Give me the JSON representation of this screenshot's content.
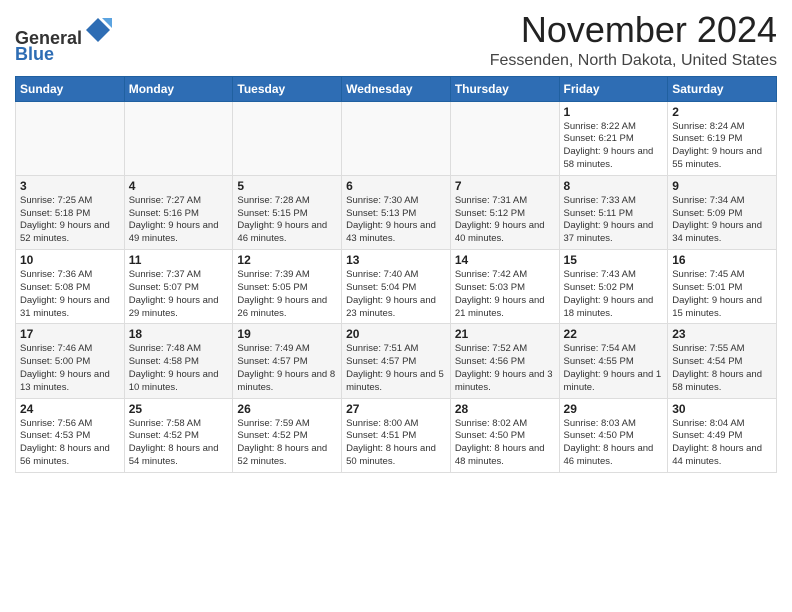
{
  "header": {
    "logo_line1": "General",
    "logo_line2": "Blue",
    "month_title": "November 2024",
    "location": "Fessenden, North Dakota, United States"
  },
  "days_of_week": [
    "Sunday",
    "Monday",
    "Tuesday",
    "Wednesday",
    "Thursday",
    "Friday",
    "Saturday"
  ],
  "weeks": [
    [
      {
        "day": "",
        "info": ""
      },
      {
        "day": "",
        "info": ""
      },
      {
        "day": "",
        "info": ""
      },
      {
        "day": "",
        "info": ""
      },
      {
        "day": "",
        "info": ""
      },
      {
        "day": "1",
        "info": "Sunrise: 8:22 AM\nSunset: 6:21 PM\nDaylight: 9 hours and 58 minutes."
      },
      {
        "day": "2",
        "info": "Sunrise: 8:24 AM\nSunset: 6:19 PM\nDaylight: 9 hours and 55 minutes."
      }
    ],
    [
      {
        "day": "3",
        "info": "Sunrise: 7:25 AM\nSunset: 5:18 PM\nDaylight: 9 hours and 52 minutes."
      },
      {
        "day": "4",
        "info": "Sunrise: 7:27 AM\nSunset: 5:16 PM\nDaylight: 9 hours and 49 minutes."
      },
      {
        "day": "5",
        "info": "Sunrise: 7:28 AM\nSunset: 5:15 PM\nDaylight: 9 hours and 46 minutes."
      },
      {
        "day": "6",
        "info": "Sunrise: 7:30 AM\nSunset: 5:13 PM\nDaylight: 9 hours and 43 minutes."
      },
      {
        "day": "7",
        "info": "Sunrise: 7:31 AM\nSunset: 5:12 PM\nDaylight: 9 hours and 40 minutes."
      },
      {
        "day": "8",
        "info": "Sunrise: 7:33 AM\nSunset: 5:11 PM\nDaylight: 9 hours and 37 minutes."
      },
      {
        "day": "9",
        "info": "Sunrise: 7:34 AM\nSunset: 5:09 PM\nDaylight: 9 hours and 34 minutes."
      }
    ],
    [
      {
        "day": "10",
        "info": "Sunrise: 7:36 AM\nSunset: 5:08 PM\nDaylight: 9 hours and 31 minutes."
      },
      {
        "day": "11",
        "info": "Sunrise: 7:37 AM\nSunset: 5:07 PM\nDaylight: 9 hours and 29 minutes."
      },
      {
        "day": "12",
        "info": "Sunrise: 7:39 AM\nSunset: 5:05 PM\nDaylight: 9 hours and 26 minutes."
      },
      {
        "day": "13",
        "info": "Sunrise: 7:40 AM\nSunset: 5:04 PM\nDaylight: 9 hours and 23 minutes."
      },
      {
        "day": "14",
        "info": "Sunrise: 7:42 AM\nSunset: 5:03 PM\nDaylight: 9 hours and 21 minutes."
      },
      {
        "day": "15",
        "info": "Sunrise: 7:43 AM\nSunset: 5:02 PM\nDaylight: 9 hours and 18 minutes."
      },
      {
        "day": "16",
        "info": "Sunrise: 7:45 AM\nSunset: 5:01 PM\nDaylight: 9 hours and 15 minutes."
      }
    ],
    [
      {
        "day": "17",
        "info": "Sunrise: 7:46 AM\nSunset: 5:00 PM\nDaylight: 9 hours and 13 minutes."
      },
      {
        "day": "18",
        "info": "Sunrise: 7:48 AM\nSunset: 4:58 PM\nDaylight: 9 hours and 10 minutes."
      },
      {
        "day": "19",
        "info": "Sunrise: 7:49 AM\nSunset: 4:57 PM\nDaylight: 9 hours and 8 minutes."
      },
      {
        "day": "20",
        "info": "Sunrise: 7:51 AM\nSunset: 4:57 PM\nDaylight: 9 hours and 5 minutes."
      },
      {
        "day": "21",
        "info": "Sunrise: 7:52 AM\nSunset: 4:56 PM\nDaylight: 9 hours and 3 minutes."
      },
      {
        "day": "22",
        "info": "Sunrise: 7:54 AM\nSunset: 4:55 PM\nDaylight: 9 hours and 1 minute."
      },
      {
        "day": "23",
        "info": "Sunrise: 7:55 AM\nSunset: 4:54 PM\nDaylight: 8 hours and 58 minutes."
      }
    ],
    [
      {
        "day": "24",
        "info": "Sunrise: 7:56 AM\nSunset: 4:53 PM\nDaylight: 8 hours and 56 minutes."
      },
      {
        "day": "25",
        "info": "Sunrise: 7:58 AM\nSunset: 4:52 PM\nDaylight: 8 hours and 54 minutes."
      },
      {
        "day": "26",
        "info": "Sunrise: 7:59 AM\nSunset: 4:52 PM\nDaylight: 8 hours and 52 minutes."
      },
      {
        "day": "27",
        "info": "Sunrise: 8:00 AM\nSunset: 4:51 PM\nDaylight: 8 hours and 50 minutes."
      },
      {
        "day": "28",
        "info": "Sunrise: 8:02 AM\nSunset: 4:50 PM\nDaylight: 8 hours and 48 minutes."
      },
      {
        "day": "29",
        "info": "Sunrise: 8:03 AM\nSunset: 4:50 PM\nDaylight: 8 hours and 46 minutes."
      },
      {
        "day": "30",
        "info": "Sunrise: 8:04 AM\nSunset: 4:49 PM\nDaylight: 8 hours and 44 minutes."
      }
    ]
  ]
}
